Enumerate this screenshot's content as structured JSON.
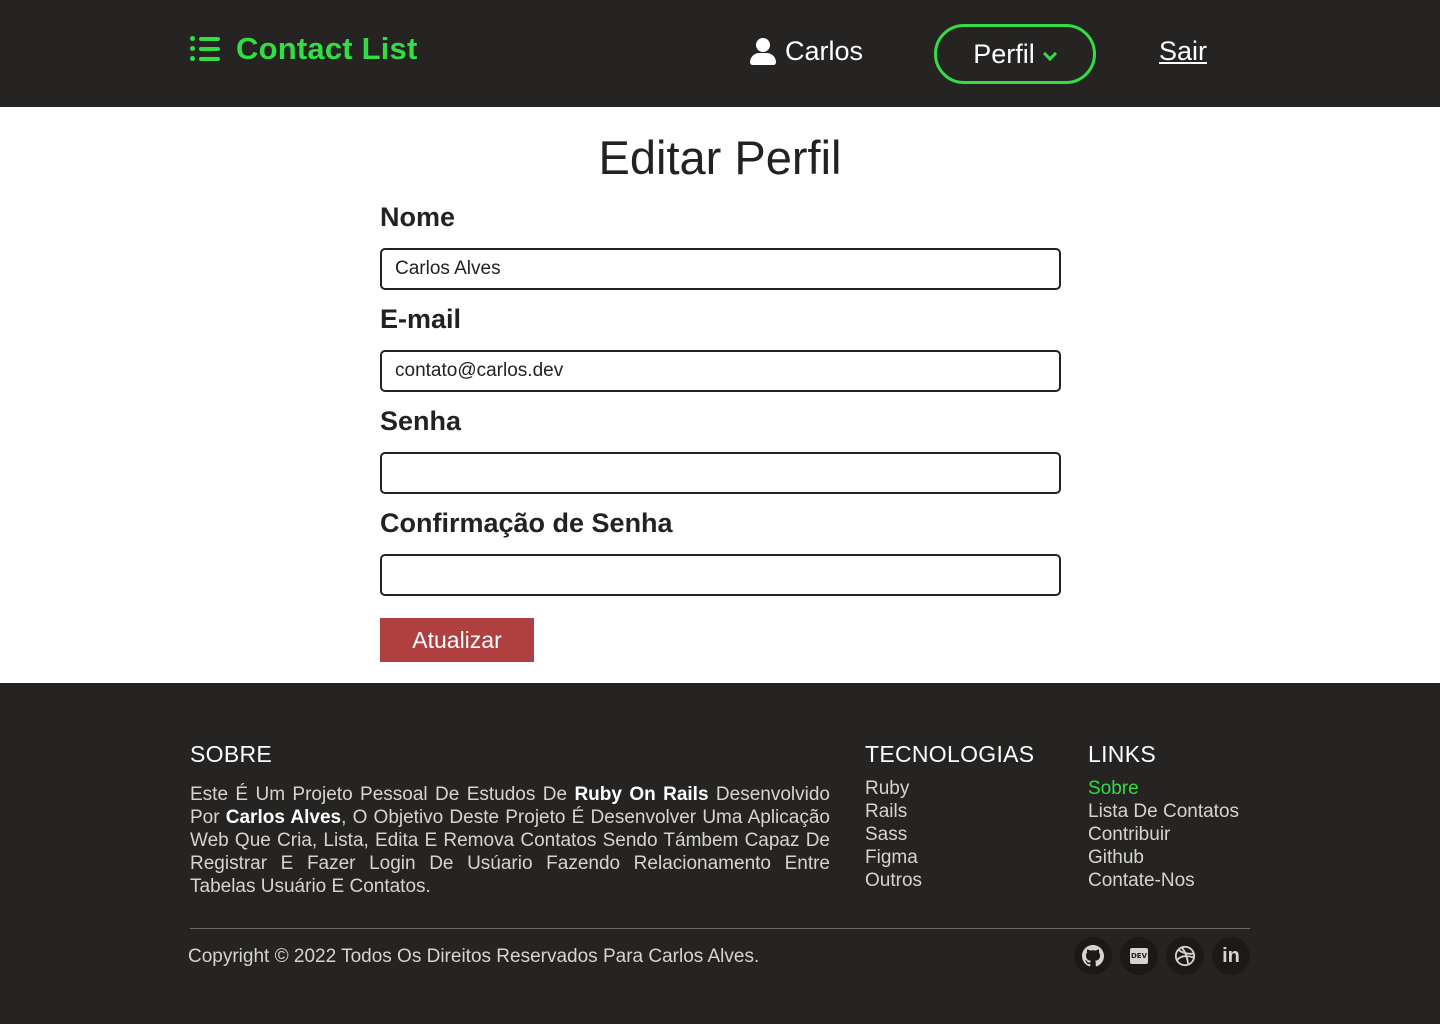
{
  "header": {
    "brand_title": "Contact List",
    "user_name": "Carlos",
    "profile_button": "Perfil",
    "logout_link": "Sair"
  },
  "form": {
    "title": "Editar Perfil",
    "fields": [
      {
        "label": "Nome",
        "value": "Carlos Alves",
        "type": "text"
      },
      {
        "label": "E-mail",
        "value": "contato@carlos.dev",
        "type": "email"
      },
      {
        "label": "Senha",
        "value": "",
        "type": "password"
      },
      {
        "label": "Confirmação de Senha",
        "value": "",
        "type": "password"
      }
    ],
    "submit_label": "Atualizar"
  },
  "footer": {
    "about": {
      "heading": "SOBRE",
      "text_1": "Este É Um Projeto Pessoal De Estudos De ",
      "bold_1": "Ruby On Rails",
      "text_2": " Desenvolvido Por ",
      "bold_2": "Carlos Alves",
      "text_3": ", O Objetivo Deste Projeto É Desenvolver Uma Aplicação Web Que Cria, Lista, Edita E Remova Contatos Sendo Támbem Capaz De Registrar E Fazer Login De Usúario Fazendo Relacionamento Entre Tabelas Usuário E Contatos."
    },
    "technologies": {
      "heading": "TECNOLOGIAS",
      "items": [
        "Ruby",
        "Rails",
        "Sass",
        "Figma",
        "Outros"
      ]
    },
    "links": {
      "heading": "LINKS",
      "items": [
        "Sobre",
        "Lista De Contatos",
        "Contribuir",
        "Github",
        "Contate-Nos"
      ],
      "active_index": 0
    },
    "copyright": "Copyright © 2022 Todos Os Direitos Reservados Para Carlos Alves.",
    "social_icons": [
      "github-icon",
      "dev-icon",
      "dribbble-icon",
      "linkedin-icon"
    ],
    "dev_icon_text": "DEV",
    "linkedin_icon_text": "in"
  },
  "colors": {
    "header_bg": "#252423",
    "accent_green": "#33dd44",
    "submit_red": "#b04040",
    "footer_bg": "#252423"
  }
}
